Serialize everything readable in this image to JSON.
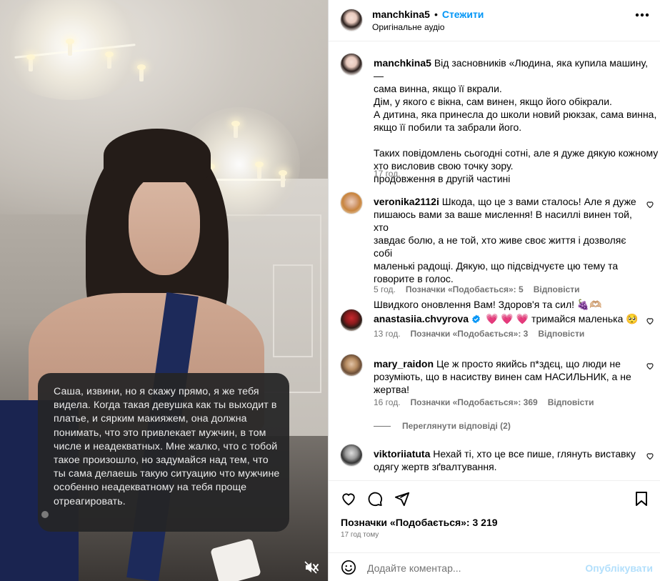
{
  "post": {
    "username": "manchkina5",
    "follow_label": "Стежити",
    "audio_label": "Оригінальне аудіо",
    "caption_lines": [
      "Від засновників «Людина, яка купила машину, —",
      "сама винна, якщо її вкрали.",
      "Дім, у якого є вікна, сам винен, якщо його обікрали.",
      "А дитина, яка принесла до школи новий рюкзак, сама винна,",
      "якщо її побили та забрали його.",
      "",
      "Таких повідомлень сьогодні сотні, але я дуже дякую кожному",
      "хто висловив свою точку зору.",
      "продовження в другій частині"
    ],
    "caption_time": "17 год.",
    "likes_label": "Позначки «Подобається»: 3 219",
    "date_label": "17 год тому",
    "comment_placeholder": "Додайте коментар...",
    "publish_label": "Опублікувати"
  },
  "media": {
    "dm_text": "Саша, извини, но я скажу прямо, я же тебя видела. Когда такая девушка как ты выходит в платье, и сярким макияжем, она должна понимать, что это привлекает мужчин, в том числе и неадекватных. Мне жалко, что с тобой такое произошло, но задумайся над тем, что ты сама делаешь такую ситуацию что мужчине особенно неадекватному на тебя проще отреагировать."
  },
  "comments": [
    {
      "username": "veronika2112i",
      "lines": [
        "Шкода, що це з вами сталось! Але я дуже",
        "пишаюсь вами за ваше мислення! В насиллі винен той, хто",
        "завдає болю, а не той, хто живе своє життя і дозволяє собі",
        "маленькі радощі. Дякую, що підсвідчуєте цю тему та",
        "говорите в голос.",
        "",
        "Швидкого оновлення Вам! Здоров'я та сил! 🍇🫶🏼"
      ],
      "time": "5 год.",
      "likes": "Позначки «Подобається»: 5",
      "reply": "Відповісти"
    },
    {
      "username": "anastasiia.chvyrova",
      "verified": true,
      "lines": [
        "💗 💗 💗 тримайся маленька 🥺"
      ],
      "time": "13 год.",
      "likes": "Позначки «Подобається»: 3",
      "reply": "Відповісти"
    },
    {
      "username": "mary_raidon",
      "lines": [
        "Це ж просто якийсь п*здєц, що люди не",
        "розуміють, що в насиству винен сам НАСИЛЬНИК, а не",
        "жертва!"
      ],
      "time": "16 год.",
      "likes": "Позначки «Подобається»: 369",
      "reply": "Відповісти",
      "replies_label": "Переглянути відповіді (2)"
    },
    {
      "username": "viktoriiatuta",
      "lines": [
        "Нехай ті, хто це все пише, глянуть виставку",
        "одягу жертв зґвалтування."
      ]
    }
  ],
  "colors": {
    "link_blue": "#0095f6",
    "muted": "#737373",
    "publish_disabled": "#b2dffc",
    "verified": "#0095f6"
  },
  "icons": [
    "heart-icon",
    "comment-icon",
    "share-icon",
    "bookmark-icon",
    "emoji-icon",
    "mute-icon",
    "more-icon",
    "verified-icon"
  ]
}
